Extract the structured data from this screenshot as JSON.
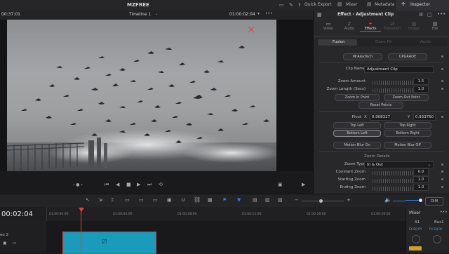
{
  "topbar": {
    "project_name": "MZFREE",
    "quick_export": "Quick Export",
    "mixer": "Mixer",
    "metadata": "Metadata",
    "inspector": "Inspector"
  },
  "viewer": {
    "timecode_left": "00:37:01",
    "timeline_name": "Timeline 1",
    "timecode_right": "01:00:02:04"
  },
  "inspector": {
    "title": "Effect - Adjustment Clip",
    "top_tabs": [
      "Video",
      "Audio",
      "Effects",
      "Transition",
      "Image",
      "File"
    ],
    "sub_tabs": [
      "Fusion",
      "Open FX",
      "Audio"
    ],
    "mr_button": "MrAlexTech",
    "upgrade_button": "UPGRADE",
    "clip_name_label": "Clip Name",
    "clip_name_value": "Adjustment Clip",
    "zoom_amount_label": "Zoom Amount",
    "zoom_amount_value": "1.5",
    "zoom_length_label": "Zoom Length (Secs)",
    "zoom_length_value": "1.0",
    "zoom_in_point": "Zoom In Point",
    "zoom_out_point": "Zoom Out Point",
    "reset_points": "Reset Points",
    "pivot_label": "Pivot",
    "pivot_x_label": "X",
    "pivot_x_value": "0.908327",
    "pivot_y_label": "Y",
    "pivot_y_value": "0.933760",
    "top_left": "Top Left",
    "top_right": "Top Right",
    "bottom_left": "Bottom Left",
    "bottom_right": "Bottom Right",
    "motion_blur_on": "Motion Blur On",
    "motion_blur_off": "Motion Blur Off",
    "zoom_details": "Zoom Details",
    "zoom_type_label": "Zoom Type",
    "zoom_type_value": "In & Out",
    "constant_zoom_label": "Constant Zoom",
    "constant_zoom_value": "0.0",
    "starting_zoom_label": "Starting Zoom",
    "starting_zoom_value": "1.0",
    "ending_zoom_label": "Ending Zoom",
    "ending_zoom_value": "1.0"
  },
  "toolbar": {
    "dim_label": "DIM"
  },
  "timeline": {
    "timecode": "00:02:04",
    "ruler": [
      "01:00:00:00",
      "01:00:04:00",
      "01:00:08:00",
      "01:00:12:00",
      "01:00:16:00",
      "01:00:20:00"
    ],
    "track_label": "eo 2"
  },
  "mixer_panel": {
    "title": "Mixer",
    "a1": "A1",
    "bus1": "Bus1",
    "fx_a1": "FX  EQ  DY",
    "fx_bus": "FX  EQ  DY"
  },
  "colors": {
    "accent_red": "#e0403b",
    "clip_blue": "#1b9bbb",
    "accent_blue": "#3a7bd5"
  }
}
